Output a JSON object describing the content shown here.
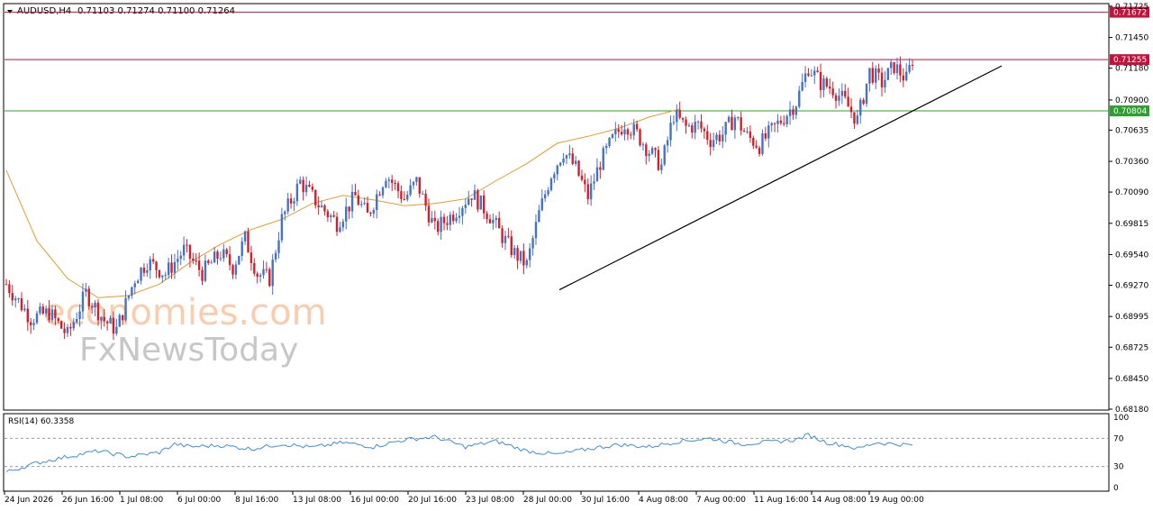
{
  "header": {
    "symbol": "AUDUSD,H4",
    "ohlc": "0.71103 0.71274 0.71100 0.71264"
  },
  "watermark": {
    "line1": "economies.com",
    "line2": "FxNewsToday"
  },
  "colors": {
    "bull": "#4472c4",
    "bear": "#d0202c",
    "ma": "#e69a2e",
    "resistance": "#c0143c",
    "support": "#2ca02c",
    "trendline": "#000000",
    "rsi": "#3c8fd8"
  },
  "chart_data": [
    {
      "type": "candlestick",
      "title": "AUDUSD,H4",
      "ylim": [
        0.6818,
        0.7174
      ],
      "y_ticks": [
        "0.71725",
        "0.71450",
        "0.71180",
        "0.70900",
        "0.70635",
        "0.70360",
        "0.70090",
        "0.69815",
        "0.69540",
        "0.69270",
        "0.68995",
        "0.68725",
        "0.68450",
        "0.68180"
      ],
      "x_labels": [
        "24 Jun 2026",
        "26 Jun 16:00",
        "1 Jul 08:00",
        "6 Jul 00:00",
        "8 Jul 16:00",
        "13 Jul 08:00",
        "16 Jul 00:00",
        "20 Jul 16:00",
        "23 Jul 08:00",
        "28 Jul 00:00",
        "30 Jul 16:00",
        "4 Aug 08:00",
        "7 Aug 00:00",
        "11 Aug 16:00",
        "14 Aug 08:00",
        "19 Aug 00:00"
      ],
      "horizontal_levels": [
        {
          "value": 0.71672,
          "label": "0.71672",
          "kind": "resistance"
        },
        {
          "value": 0.71255,
          "label": "0.71255",
          "kind": "resistance"
        },
        {
          "value": 0.70804,
          "label": "0.70804",
          "kind": "support"
        }
      ],
      "trendline": {
        "from": [
          0.0,
          0.6923
        ],
        "to": [
          1.0,
          0.712
        ]
      },
      "moving_average_anchors": [
        [
          0,
          0.7028
        ],
        [
          10,
          0.6966
        ],
        [
          20,
          0.6933
        ],
        [
          30,
          0.6916
        ],
        [
          40,
          0.6918
        ],
        [
          50,
          0.6928
        ],
        [
          60,
          0.6947
        ],
        [
          70,
          0.6963
        ],
        [
          80,
          0.6976
        ],
        [
          90,
          0.6985
        ],
        [
          100,
          0.6999
        ],
        [
          110,
          0.7006
        ],
        [
          120,
          0.7002
        ],
        [
          130,
          0.6997
        ],
        [
          140,
          0.6999
        ],
        [
          150,
          0.7003
        ],
        [
          160,
          0.7019
        ],
        [
          170,
          0.7034
        ],
        [
          180,
          0.7052
        ],
        [
          190,
          0.7058
        ],
        [
          200,
          0.7065
        ],
        [
          210,
          0.7075
        ],
        [
          220,
          0.7082
        ]
      ],
      "price_path": [
        [
          0,
          0.6928
        ],
        [
          8,
          0.6898
        ],
        [
          14,
          0.6903
        ],
        [
          20,
          0.6883
        ],
        [
          26,
          0.692
        ],
        [
          32,
          0.6896
        ],
        [
          36,
          0.6888
        ],
        [
          42,
          0.6933
        ],
        [
          46,
          0.6948
        ],
        [
          52,
          0.6937
        ],
        [
          58,
          0.6958
        ],
        [
          64,
          0.6938
        ],
        [
          70,
          0.6955
        ],
        [
          74,
          0.6943
        ],
        [
          78,
          0.6968
        ],
        [
          82,
          0.6937
        ],
        [
          86,
          0.6933
        ],
        [
          90,
          0.6985
        ],
        [
          96,
          0.7018
        ],
        [
          102,
          0.6998
        ],
        [
          108,
          0.6982
        ],
        [
          114,
          0.7005
        ],
        [
          118,
          0.6988
        ],
        [
          124,
          0.7025
        ],
        [
          130,
          0.7003
        ],
        [
          134,
          0.7018
        ],
        [
          140,
          0.6976
        ],
        [
          146,
          0.699
        ],
        [
          152,
          0.7008
        ],
        [
          158,
          0.6988
        ],
        [
          162,
          0.697
        ],
        [
          166,
          0.6955
        ],
        [
          170,
          0.6945
        ],
        [
          174,
          0.699
        ],
        [
          178,
          0.7025
        ],
        [
          182,
          0.7045
        ],
        [
          186,
          0.703
        ],
        [
          190,
          0.7005
        ],
        [
          194,
          0.7035
        ],
        [
          198,
          0.7055
        ],
        [
          202,
          0.707
        ],
        [
          206,
          0.706
        ],
        [
          210,
          0.7045
        ],
        [
          214,
          0.7032
        ],
        [
          218,
          0.7077
        ],
        [
          222,
          0.7066
        ],
        [
          226,
          0.7068
        ],
        [
          230,
          0.7055
        ],
        [
          234,
          0.706
        ],
        [
          238,
          0.7075
        ],
        [
          242,
          0.7058
        ],
        [
          246,
          0.705
        ],
        [
          250,
          0.7063
        ],
        [
          254,
          0.7075
        ],
        [
          258,
          0.7088
        ],
        [
          262,
          0.7119
        ],
        [
          266,
          0.7105
        ],
        [
          270,
          0.71
        ],
        [
          274,
          0.7088
        ],
        [
          278,
          0.7072
        ],
        [
          282,
          0.7115
        ],
        [
          286,
          0.7105
        ],
        [
          290,
          0.712
        ],
        [
          294,
          0.7108
        ],
        [
          296,
          0.7126
        ]
      ]
    },
    {
      "type": "line",
      "title": "RSI(14) 60.3358",
      "ylim": [
        0,
        100
      ],
      "y_ticks": [
        "100",
        "70",
        "30",
        "0"
      ],
      "levels": [
        70,
        30
      ],
      "rsi_path": [
        [
          0,
          22
        ],
        [
          10,
          35
        ],
        [
          20,
          44
        ],
        [
          30,
          52
        ],
        [
          40,
          44
        ],
        [
          50,
          50
        ],
        [
          55,
          62
        ],
        [
          60,
          58
        ],
        [
          70,
          60
        ],
        [
          80,
          55
        ],
        [
          90,
          62
        ],
        [
          100,
          57
        ],
        [
          110,
          64
        ],
        [
          120,
          58
        ],
        [
          130,
          68
        ],
        [
          140,
          72
        ],
        [
          150,
          58
        ],
        [
          160,
          66
        ],
        [
          170,
          52
        ],
        [
          180,
          47
        ],
        [
          190,
          55
        ],
        [
          200,
          61
        ],
        [
          210,
          58
        ],
        [
          220,
          66
        ],
        [
          230,
          70
        ],
        [
          240,
          62
        ],
        [
          250,
          65
        ],
        [
          258,
          68
        ],
        [
          262,
          75
        ],
        [
          268,
          64
        ],
        [
          274,
          60
        ],
        [
          278,
          55
        ],
        [
          284,
          64
        ],
        [
          290,
          62
        ],
        [
          296,
          60.3358
        ]
      ]
    }
  ]
}
